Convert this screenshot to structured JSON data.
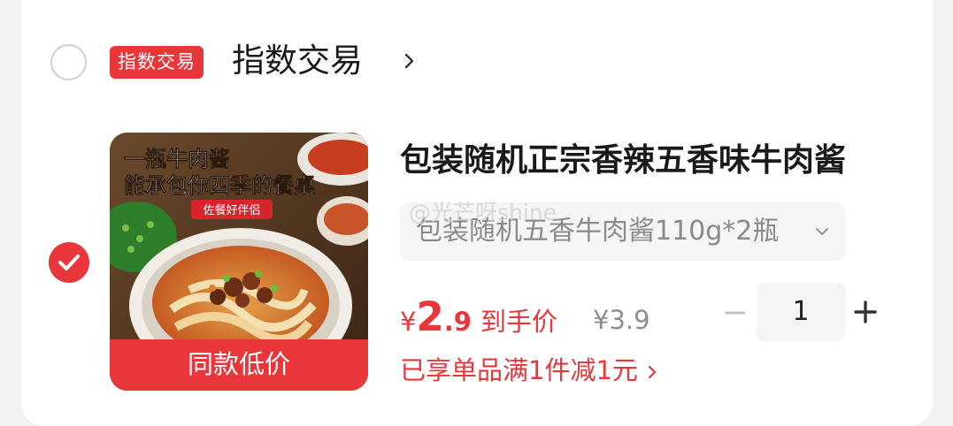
{
  "shop": {
    "badge": "指数交易",
    "name": "指数交易"
  },
  "item": {
    "image_overlay": {
      "line1": "一瓶牛肉酱",
      "line2": "能承包你四季的餐桌",
      "tag": "佐餐好伴侣",
      "ribbon": "同款低价"
    },
    "title": "包装随机正宗香辣五香味牛肉酱",
    "variant": "包装随机五香牛肉酱110g*2瓶",
    "watermark": "@光芒呀shine",
    "price": {
      "currency": "¥",
      "integer": "2",
      "decimal": ".9",
      "label": "到手价"
    },
    "original_price": "¥3.9",
    "quantity": "1",
    "promo": "已享单品满1件减1元"
  },
  "colors": {
    "accent": "#e8363a",
    "muted": "#8e8e8e",
    "background": "#f2f2f2"
  },
  "icons": {
    "shop_chevron": "chevron-right-icon",
    "variant_chevron": "chevron-down-icon",
    "minus": "minus-icon",
    "plus": "plus-icon",
    "check": "check-icon"
  }
}
